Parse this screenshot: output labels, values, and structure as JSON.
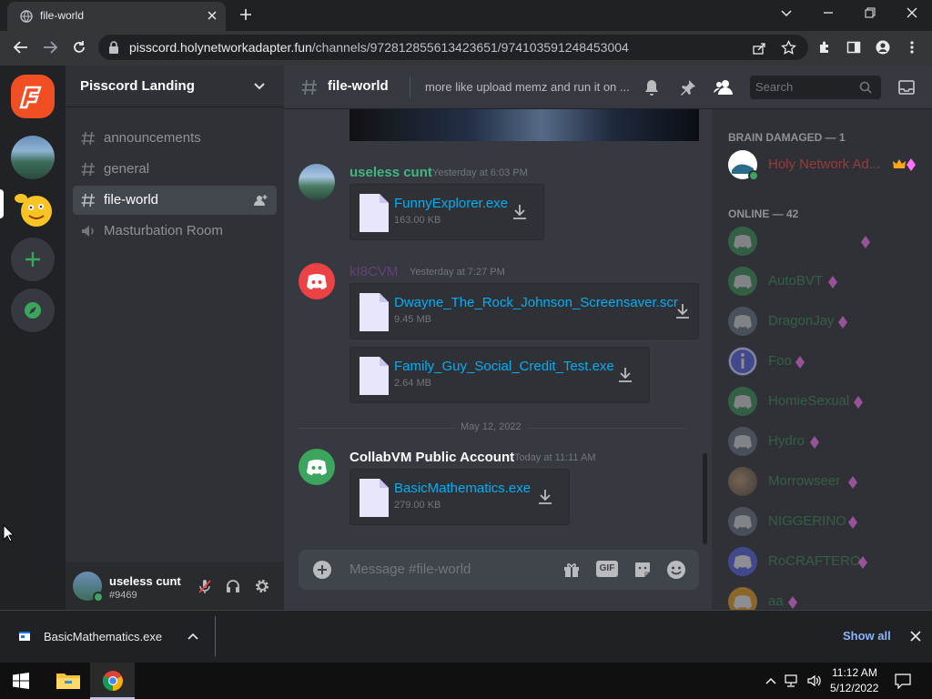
{
  "browser": {
    "tab_title": "file-world",
    "url_domain": "pisscord.holynetworkadapter.fun",
    "url_path": "/channels/972812855613423651/974103591248453004"
  },
  "server": {
    "name": "Pisscord Landing",
    "channels": [
      {
        "label": "announcements",
        "type": "text"
      },
      {
        "label": "general",
        "type": "text"
      },
      {
        "label": "file-world",
        "type": "text",
        "selected": true
      },
      {
        "label": "Masturbation Room",
        "type": "voice"
      }
    ]
  },
  "channel_header": {
    "name": "file-world",
    "topic": "more like upload memz and run it on ...",
    "search_placeholder": "Search"
  },
  "messages": [
    {
      "author": "useless cunt",
      "author_color": "#43b581",
      "time": "Yesterday at 6:03 PM",
      "files": [
        {
          "name": "FunnyExplorer.exe",
          "size": "163.00 KB"
        }
      ]
    },
    {
      "author": "kI8CVM",
      "author_color": "#8e44ad",
      "time": "Yesterday at 7:27 PM",
      "files": [
        {
          "name": "Dwayne_The_Rock_Johnson_Screensaver.scr",
          "size": "9.45 MB"
        },
        {
          "name": "Family_Guy_Social_Credit_Test.exe",
          "size": "2.64 MB"
        }
      ]
    },
    {
      "divider": "May 12, 2022",
      "author": "CollabVM Public Account",
      "author_color": "#ffffff",
      "time": "Today at 11:11 AM",
      "files": [
        {
          "name": "BasicMathematics.exe",
          "size": "279.00 KB"
        }
      ]
    }
  ],
  "composer": {
    "placeholder": "Message #file-world",
    "gif_label": "GIF"
  },
  "user_panel": {
    "name": "useless cunt",
    "tag": "#9469"
  },
  "members": {
    "group1_label": "BRAIN DAMAGED — 1",
    "group1": [
      {
        "name": "Holy Network Ad...",
        "color": "#ed4245"
      }
    ],
    "group2_label": "ONLINE — 42",
    "group2": [
      {
        "name": "",
        "icon": "discord-green"
      },
      {
        "name": "AutoBVT",
        "icon": "discord-green"
      },
      {
        "name": "DragonJay",
        "icon": "discord-gray"
      },
      {
        "name": "Foo",
        "icon": "info-blue"
      },
      {
        "name": "HomieSexual",
        "icon": "discord-green"
      },
      {
        "name": "Hydro",
        "icon": "discord-gray"
      },
      {
        "name": "Morrowseer",
        "icon": "photo"
      },
      {
        "name": "NIGGERINO",
        "icon": "discord-gray"
      },
      {
        "name": "RoCRAFTERO",
        "icon": "discord-blurple"
      },
      {
        "name": "aa",
        "icon": "discord-yellow"
      }
    ]
  },
  "download_shelf": {
    "file": "BasicMathematics.exe",
    "show_all": "Show all"
  },
  "taskbar": {
    "time": "11:12 AM",
    "date": "5/12/2022"
  },
  "colors": {
    "discord_bg": "#36393f",
    "sidebar": "#2f3136",
    "guilds": "#202225",
    "link": "#00aff4",
    "accent": "#5865f2"
  }
}
